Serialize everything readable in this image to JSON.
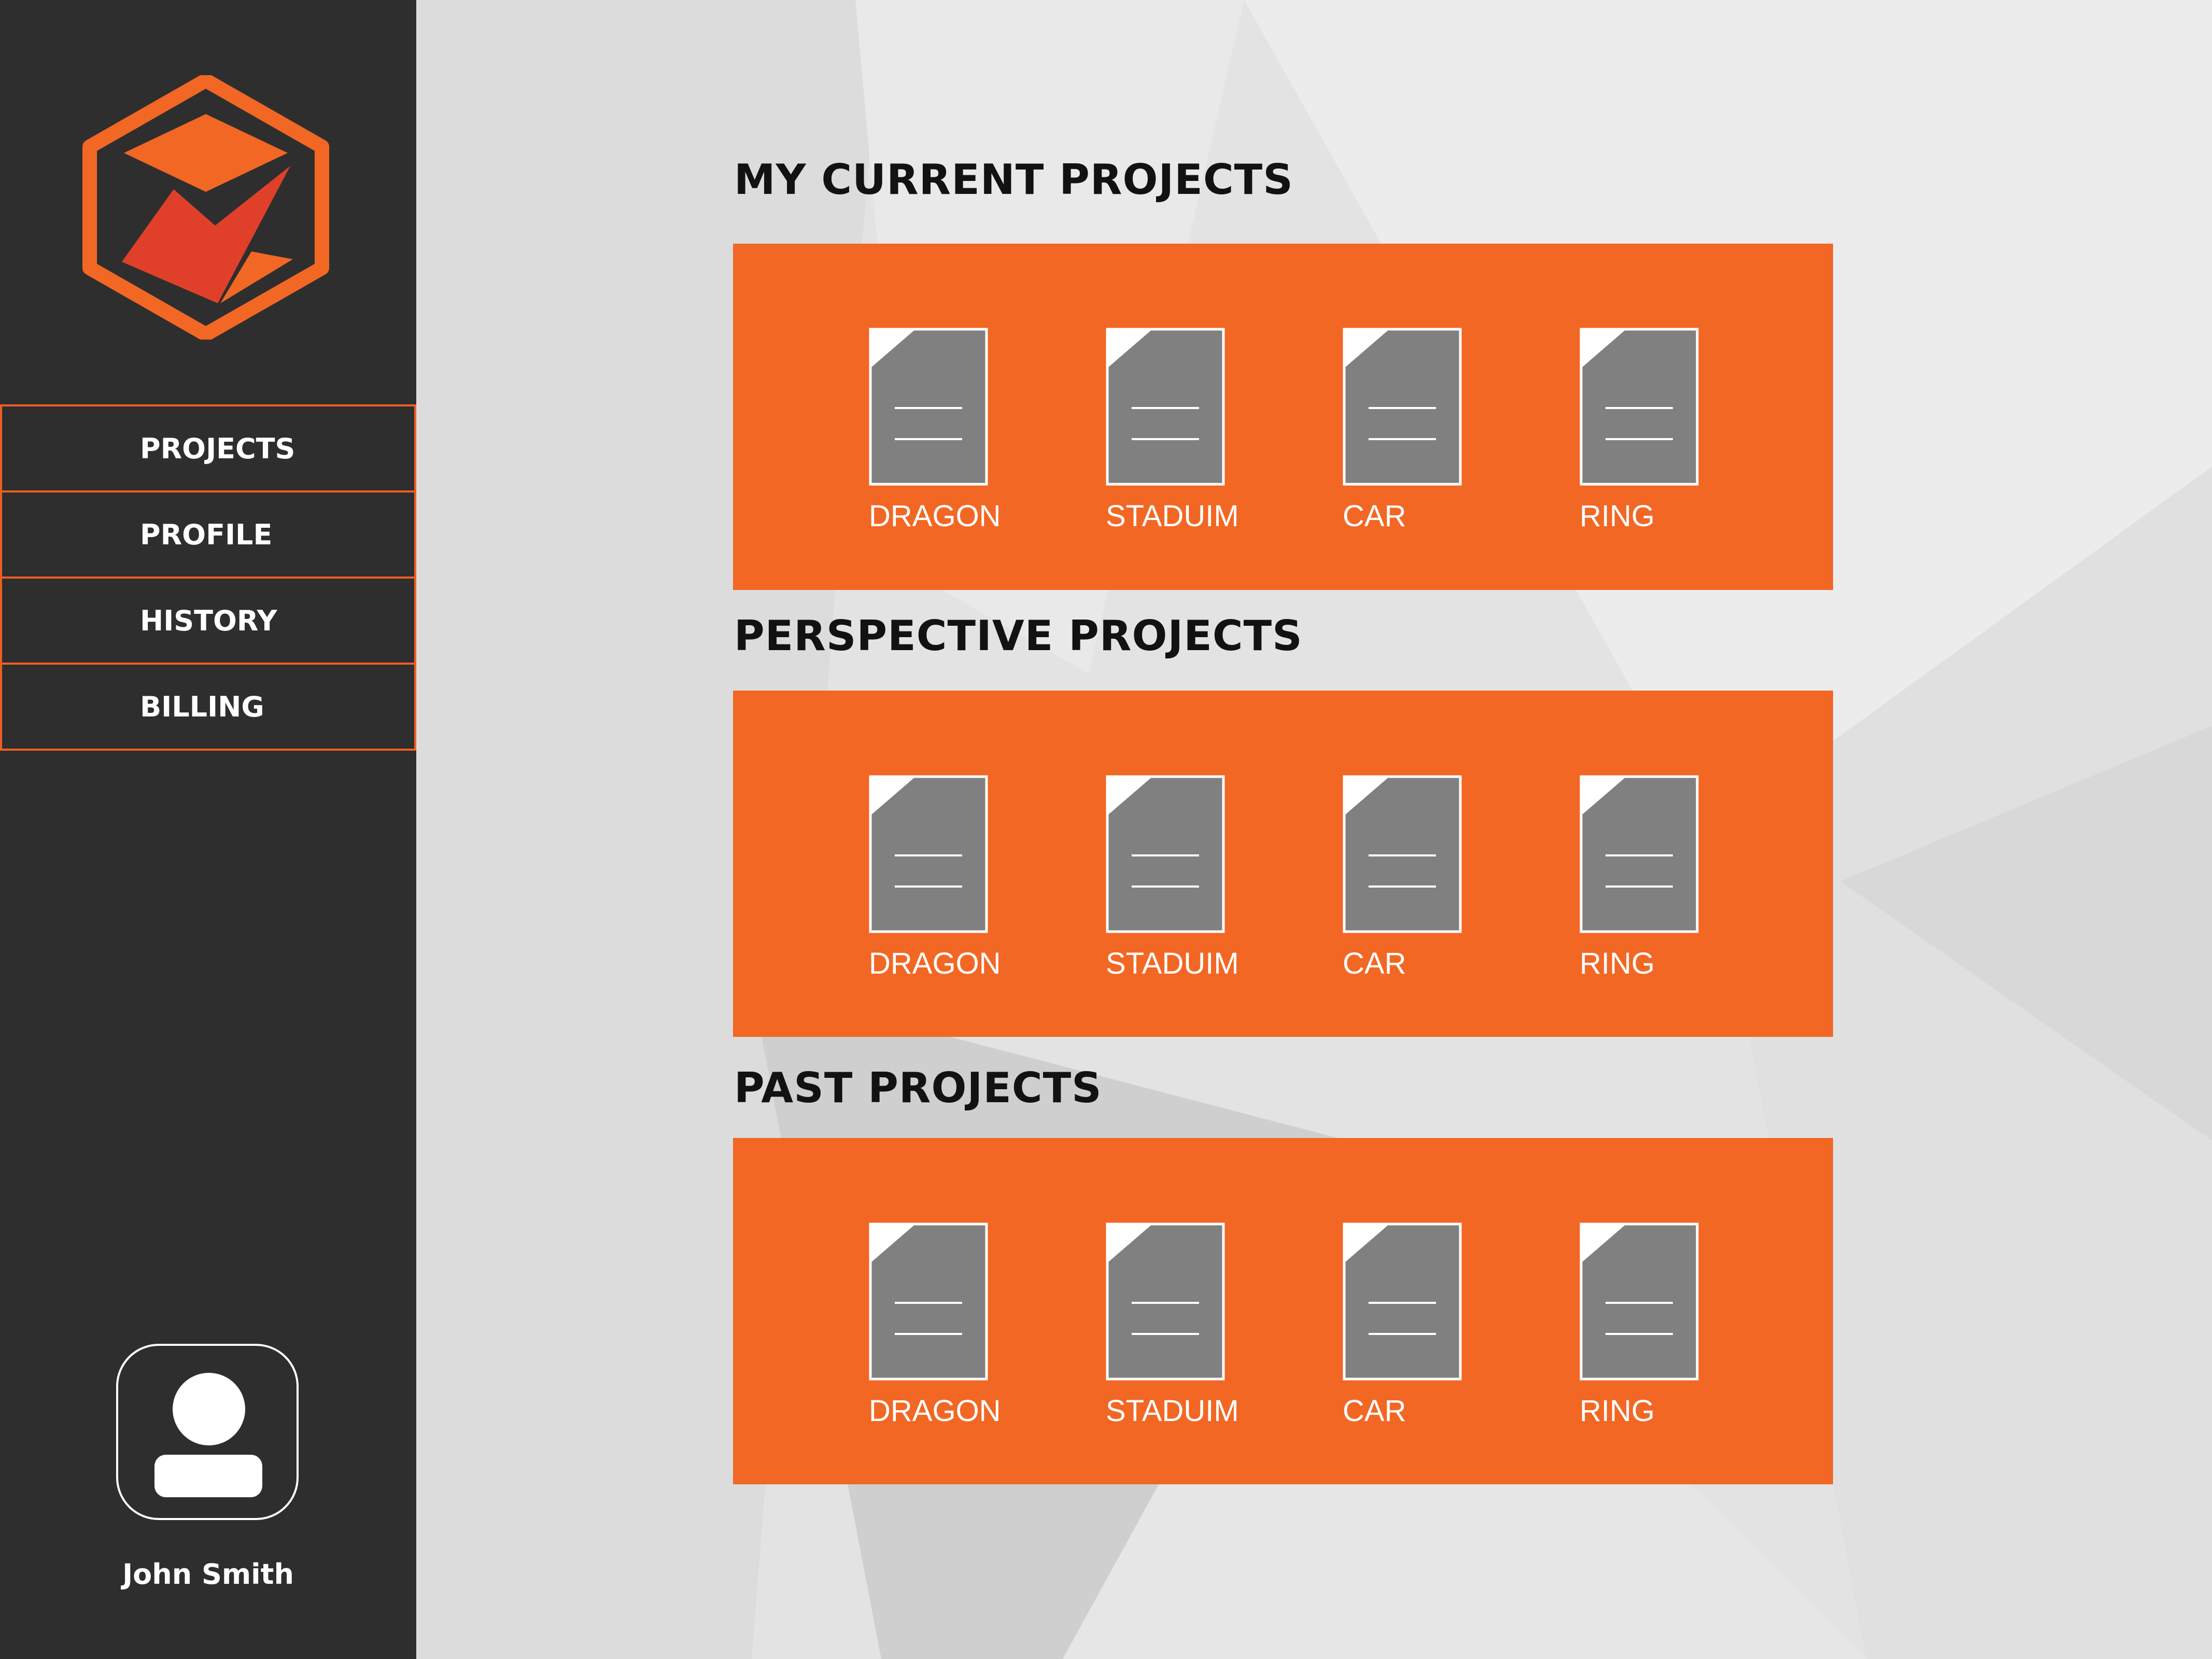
{
  "app": {
    "logo_icon": "hexagon-cube-logo-icon",
    "accent_color": "#f26724"
  },
  "sidebar": {
    "items": [
      {
        "label": "PROJECTS"
      },
      {
        "label": "PROFILE"
      },
      {
        "label": "HISTORY"
      },
      {
        "label": "BILLING"
      }
    ],
    "user": {
      "name": "John Smith",
      "avatar_icon": "user-avatar-icon"
    }
  },
  "sections": [
    {
      "title": "MY CURRENT PROJECTS",
      "files": [
        {
          "label": "DRAGON",
          "icon": "document-icon"
        },
        {
          "label": "STADUIM",
          "icon": "document-icon"
        },
        {
          "label": "CAR",
          "icon": "document-icon"
        },
        {
          "label": "RING",
          "icon": "document-icon"
        }
      ]
    },
    {
      "title": "PERSPECTIVE PROJECTS",
      "files": [
        {
          "label": "DRAGON",
          "icon": "document-icon"
        },
        {
          "label": "STADUIM",
          "icon": "document-icon"
        },
        {
          "label": "CAR",
          "icon": "document-icon"
        },
        {
          "label": "RING",
          "icon": "document-icon"
        }
      ]
    },
    {
      "title": "PAST PROJECTS",
      "files": [
        {
          "label": "DRAGON",
          "icon": "document-icon"
        },
        {
          "label": "STADUIM",
          "icon": "document-icon"
        },
        {
          "label": "CAR",
          "icon": "document-icon"
        },
        {
          "label": "RING",
          "icon": "document-icon"
        }
      ]
    }
  ]
}
